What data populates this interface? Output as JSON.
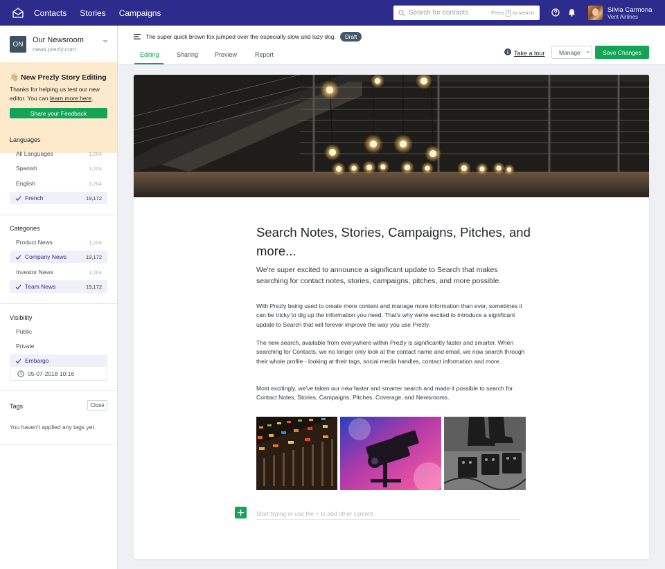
{
  "nav": {
    "links": [
      "Contacts",
      "Stories",
      "Campaigns"
    ],
    "search_placeholder": "Search for contacts",
    "search_hint_prefix": "Press",
    "search_hint_key": "/",
    "search_hint_suffix": "to search",
    "user_name": "Silvia Carmona",
    "user_org": "Vent Airlines"
  },
  "sidebar": {
    "newsroom": {
      "badge": "ON",
      "name": "Our Newsroom",
      "url": "news.prezly.com"
    },
    "promo": {
      "title": "👋🏼 New Prezly Story Editing",
      "text_before": "Thanks for helping us test our new editor. You can ",
      "link": "learn more here",
      "text_after": ".",
      "button": "Share your Feedback"
    },
    "languages": {
      "title": "Languages",
      "items": [
        {
          "label": "All Languages",
          "count": "1,204",
          "selected": false
        },
        {
          "label": "Spanish",
          "count": "1,204",
          "selected": false
        },
        {
          "label": "English",
          "count": "1,204",
          "selected": false
        },
        {
          "label": "French",
          "count": "19,172",
          "selected": true
        }
      ]
    },
    "categories": {
      "title": "Categories",
      "items": [
        {
          "label": "Product News",
          "count": "1,204",
          "selected": false
        },
        {
          "label": "Company News",
          "count": "19,172",
          "selected": true
        },
        {
          "label": "Investor News",
          "count": "1,204",
          "selected": false
        },
        {
          "label": "Team News",
          "count": "19,172",
          "selected": true
        }
      ]
    },
    "visibility": {
      "title": "Visibility",
      "items": [
        {
          "label": "Public",
          "selected": false
        },
        {
          "label": "Private",
          "selected": false
        },
        {
          "label": "Embargo",
          "selected": true
        }
      ],
      "embargo_date": "05-07-2018 10:16"
    },
    "tags": {
      "title": "Tags",
      "close": "Close",
      "empty": "You haven't applied any tags yet."
    }
  },
  "header": {
    "story_title": "The super quick brown fox jumped over the especially slow and lazy dog.",
    "status": "Draft",
    "tabs": [
      "Editing",
      "Sharing",
      "Preview",
      "Report"
    ],
    "active_tab": "Editing",
    "tour": "Take a tour",
    "manage": "Manage",
    "save": "Save Changes"
  },
  "article": {
    "title": "Search Notes, Stories, Campaigns, Pitches, and more...",
    "lead": "We're super excited to announce a significant update to Search that makes searching for contact notes, stories, campaigns, pitches, and more possible.",
    "paragraphs": [
      "With Prezly being used to create more content and manage more information than ever, sometimes it can be tricky to dig up the information you need. That's why we're excited to introduce a significant update to Search that will forever improve the way you use Prezly.",
      "The new search, available from everywhere within Prezly is significantly faster and smarter. When searching for Contacts, we no longer only look at the contact name and email, we now search through their whole profile - looking at their tags, social media handles, contact information and more.",
      "Most excitingly, we've taken our new faster and smarter search and made it possible to search for Contact Notes, Stories, Campaigns, Pitches, Coverage, and Newsrooms."
    ],
    "add_placeholder": "Start typing or use the + to add other content"
  },
  "colors": {
    "nav": "#2d2c8c",
    "accent": "#13a456",
    "promo": "#fde9cb",
    "draft": "#445a6a"
  },
  "icons": [
    "prezly-logo-icon",
    "search-icon",
    "help-icon",
    "bell-icon",
    "menu-icon",
    "info-icon",
    "check-icon",
    "clock-icon",
    "plus-icon"
  ]
}
